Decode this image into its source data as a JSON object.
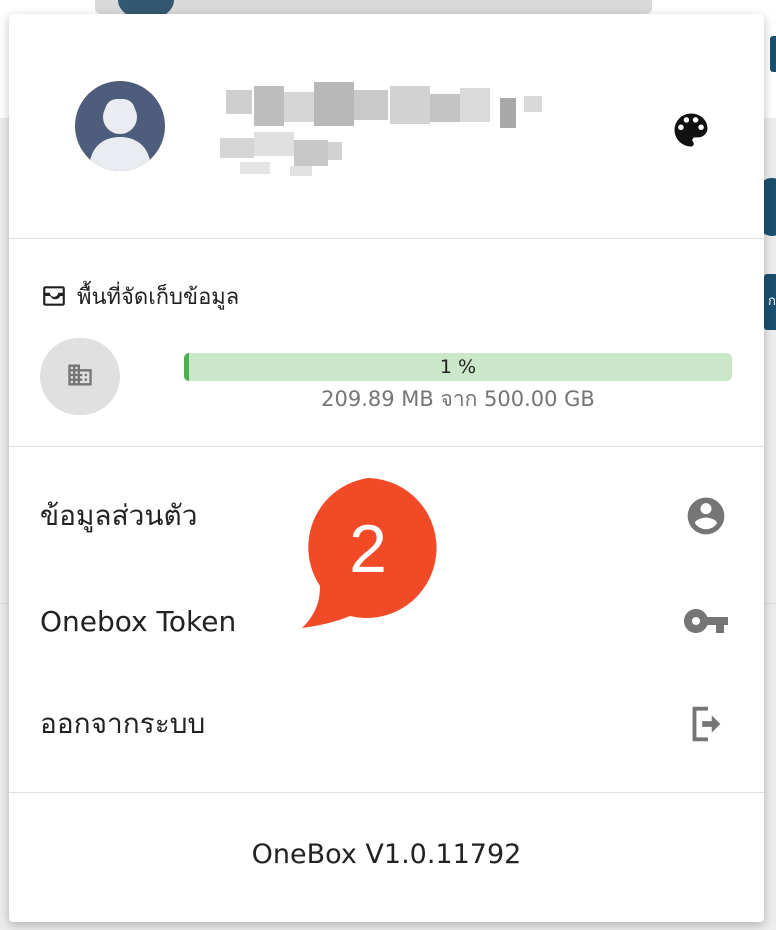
{
  "storage": {
    "title": "พื้นที่จัดเก็บข้อมูล",
    "percent_label": "1 %",
    "percent_value": 1,
    "usage_text": "209.89 MB จาก 500.00 GB",
    "bar_color": "#4caf50",
    "track_color": "#cbe7c9"
  },
  "menu": {
    "items": [
      {
        "label": "ข้อมูลส่วนตัว",
        "icon": "account-circle-icon"
      },
      {
        "label": "Onebox Token",
        "icon": "key-icon"
      },
      {
        "label": "ออกจากระบบ",
        "icon": "logout-icon"
      }
    ]
  },
  "callout": {
    "number": "2",
    "color": "#f24a26"
  },
  "footer": {
    "version": "OneBox V1.0.11792"
  },
  "background": {
    "side_button_text": "ก"
  },
  "icons": {
    "avatar": "user-avatar-icon",
    "theme": "palette-icon",
    "storage": "storage-box-icon",
    "business": "building-icon"
  }
}
